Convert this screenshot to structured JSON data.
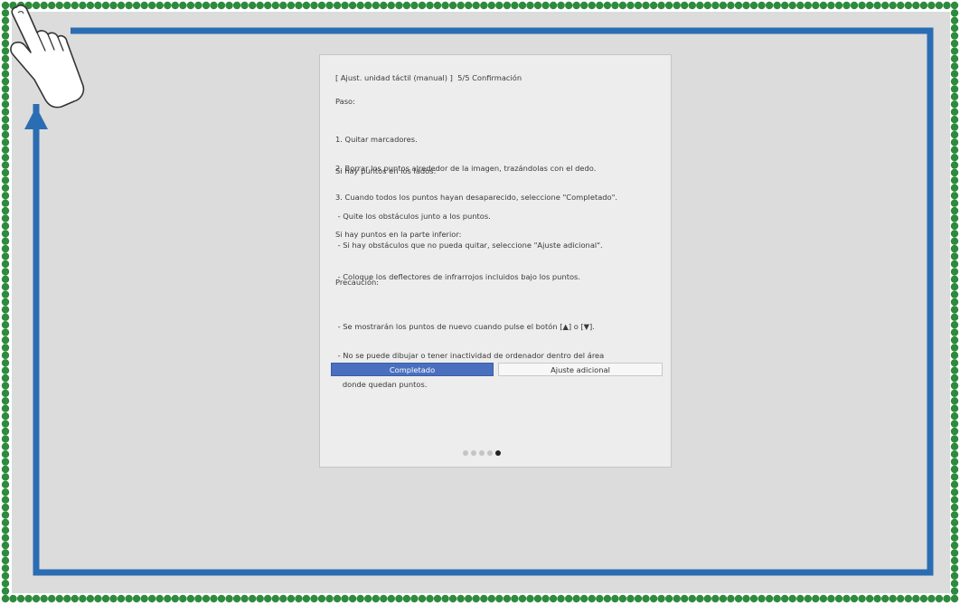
{
  "panel": {
    "title": "[ Ajust. unidad táctil (manual) ]  5/5 Confirmación",
    "paso_heading": "Paso:",
    "steps": [
      "1. Quitar marcadores.",
      "2. Borrar los puntos alrededor de la imagen, trazándolas con el dedo.",
      "3. Cuando todos los puntos hayan desaparecido, seleccione \"Completado\"."
    ],
    "sides_heading": "Si hay puntos en los lados:",
    "sides_items": [
      " - Quite los obstáculos junto a los puntos.",
      " - Si hay obstáculos que no pueda quitar, seleccione \"Ajuste adicional\"."
    ],
    "bottom_heading": "Si hay puntos en la parte inferior:",
    "bottom_items": [
      " - Coloque los deflectores de infrarrojos incluidos bajo los puntos."
    ],
    "caution_heading": "Precaución:",
    "caution_items": [
      " - Se mostrarán los puntos de nuevo cuando pulse el botón [▲] o [▼].",
      " - No se puede dibujar o tener inactividad de ordenador dentro del área",
      "   donde quedan puntos."
    ],
    "buttons": {
      "done_label": "Completado",
      "extra_label": "Ajuste adicional"
    },
    "pager": {
      "pages": 5,
      "current": 5
    }
  },
  "icons": {
    "hand": "pointing-hand-icon",
    "path_arrow": "trace-path-arrow"
  },
  "colors": {
    "screen_bg": "#dcdcdc",
    "dots": "#2e8b3e",
    "arrow": "#2b6db3",
    "primary_button": "#4a6fbf"
  }
}
